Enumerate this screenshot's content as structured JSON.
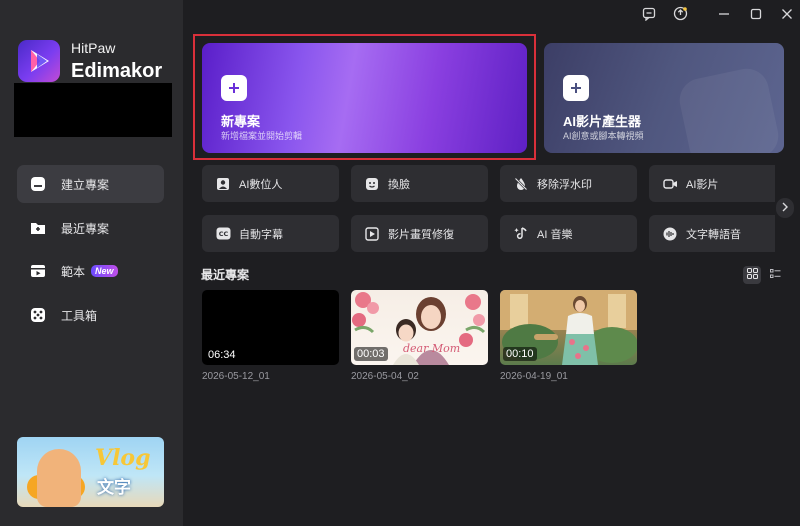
{
  "brand": {
    "line1": "HitPaw",
    "line2": "Edimakor"
  },
  "sidebar": {
    "items": [
      {
        "label": "建立專案",
        "icon": "create-project-icon",
        "active": true
      },
      {
        "label": "最近專案",
        "icon": "recent-folder-icon",
        "active": false
      },
      {
        "label": "範本",
        "icon": "template-icon",
        "active": false,
        "badge": "New"
      },
      {
        "label": "工具箱",
        "icon": "toolbox-icon",
        "active": false
      }
    ],
    "promo": {
      "vlog": "Vlog",
      "text": "文字"
    }
  },
  "titlebar": {
    "icons": [
      "feedback-icon",
      "upgrade-icon",
      "minimize-icon",
      "maximize-icon",
      "close-icon"
    ]
  },
  "hero": {
    "new_project": {
      "title": "新專案",
      "subtitle": "新增檔案並開始剪輯"
    },
    "ai_generator": {
      "title": "AI影片產生器",
      "subtitle": "AI創意或腳本轉視頻"
    }
  },
  "tools": [
    {
      "label": "AI數位人",
      "icon": "ai-avatar-icon"
    },
    {
      "label": "換臉",
      "icon": "face-swap-icon"
    },
    {
      "label": "移除浮水印",
      "icon": "remove-watermark-icon"
    },
    {
      "label": "AI影片",
      "icon": "ai-video-icon"
    },
    {
      "label": "自動字幕",
      "icon": "auto-subtitle-icon"
    },
    {
      "label": "影片畫質修復",
      "icon": "video-enhance-icon"
    },
    {
      "label": "AI 音樂",
      "icon": "ai-music-icon"
    },
    {
      "label": "文字轉語音",
      "icon": "text-to-speech-icon"
    }
  ],
  "recent": {
    "title": "最近專案",
    "projects": [
      {
        "duration": "06:34",
        "name": "2026-05-12_01"
      },
      {
        "duration": "00:03",
        "name": "2026-05-04_02",
        "caption": "dear Mom"
      },
      {
        "duration": "00:10",
        "name": "2026-04-19_01"
      }
    ]
  },
  "colors": {
    "accent": "#7a3df0",
    "highlight_border": "#d9303a",
    "sidebar_bg": "#2b2b2e",
    "main_bg": "#1e1e21"
  }
}
